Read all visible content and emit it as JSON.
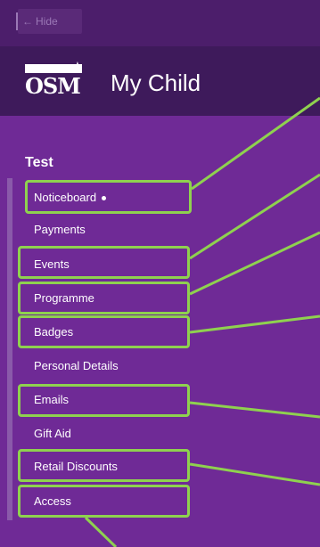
{
  "topbar": {
    "hide_label": "Hide",
    "hide_icon": "arrow-left-icon"
  },
  "header": {
    "logo_text": "OSM",
    "title": "My Child"
  },
  "sidebar": {
    "group_title": "Test",
    "items": [
      {
        "label": "Noticeboard",
        "badge_dot": true,
        "highlighted": true
      },
      {
        "label": "Payments",
        "badge_dot": false,
        "highlighted": false
      },
      {
        "label": "Events",
        "badge_dot": false,
        "highlighted": true
      },
      {
        "label": "Programme",
        "badge_dot": false,
        "highlighted": true
      },
      {
        "label": "Badges",
        "badge_dot": false,
        "highlighted": true
      },
      {
        "label": "Personal Details",
        "badge_dot": false,
        "highlighted": false
      },
      {
        "label": "Emails",
        "badge_dot": false,
        "highlighted": true
      },
      {
        "label": "Gift Aid",
        "badge_dot": false,
        "highlighted": false
      },
      {
        "label": "Retail Discounts",
        "badge_dot": false,
        "highlighted": true
      },
      {
        "label": "Access",
        "badge_dot": false,
        "highlighted": true
      }
    ]
  },
  "colors": {
    "background": "#6f2a96",
    "topbar": "#4c1e6b",
    "header": "#3e1a5b",
    "annotation": "#8fd14f"
  }
}
